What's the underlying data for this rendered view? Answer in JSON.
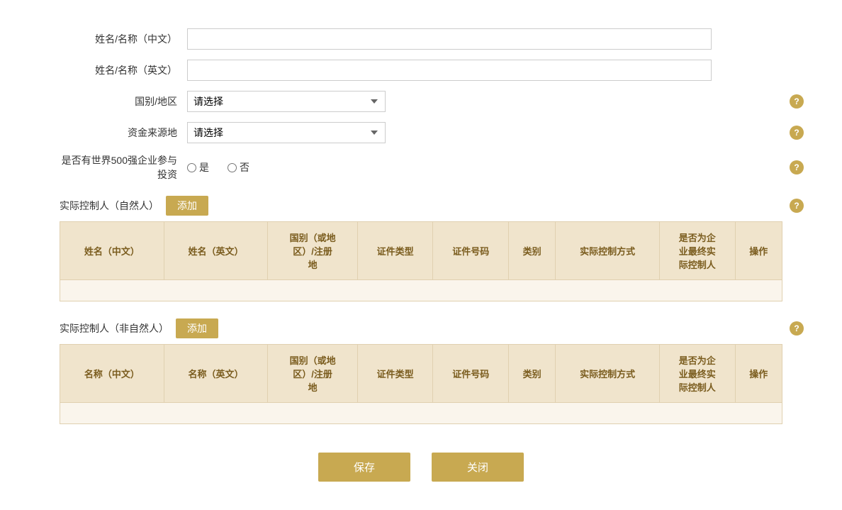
{
  "form": {
    "name_cn_label": "姓名/名称（中文）",
    "name_en_label": "姓名/名称（英文）",
    "country_label": "国别/地区",
    "fund_source_label": "资金来源地",
    "fortune500_label": "是否有世界500强企业参与投资",
    "name_cn_value": "",
    "name_en_value": "",
    "country_placeholder": "请选择",
    "fund_source_placeholder": "请选择",
    "yes_label": "是",
    "no_label": "否"
  },
  "natural_person_section": {
    "title": "实际控制人（自然人）",
    "add_label": "添加",
    "columns": [
      "姓名（中文）",
      "姓名（英文）",
      "国别（或地区）/注册地",
      "证件类型",
      "证件号码",
      "类别",
      "实际控制方式",
      "是否为企业最终实际控制人",
      "操作"
    ]
  },
  "non_natural_person_section": {
    "title": "实际控制人（非自然人）",
    "add_label": "添加",
    "columns": [
      "名称（中文）",
      "名称（英文）",
      "国别（或地区）/注册地",
      "证件类型",
      "证件号码",
      "类别",
      "实际控制方式",
      "是否为企业最终实际控制人",
      "操作"
    ]
  },
  "buttons": {
    "save_label": "保存",
    "close_label": "关闭"
  },
  "help_icon": "?",
  "colors": {
    "gold": "#c8a951",
    "table_bg": "#f0e4cc",
    "table_border": "#e0d0b0"
  }
}
